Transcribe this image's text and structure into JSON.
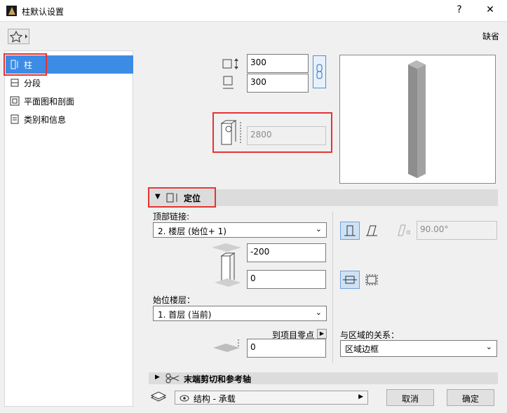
{
  "window": {
    "title": "柱默认设置",
    "help": "?",
    "close": "✕"
  },
  "toolbar": {
    "default_label": "缺省"
  },
  "nav": {
    "items": [
      {
        "label": "柱",
        "selected": true
      },
      {
        "label": "分段"
      },
      {
        "label": "平面图和剖面"
      },
      {
        "label": "类别和信息"
      }
    ]
  },
  "dimensions": {
    "width": "300",
    "depth": "300",
    "height": "2800"
  },
  "positioning": {
    "title": "定位",
    "top_link_label": "顶部链接:",
    "top_link_value": "2. 楼层 (始位+ 1)",
    "top_offset": "-200",
    "bottom_offset": "0",
    "home_story_label": "始位楼层：",
    "home_story_value": "1. 首层 (当前)",
    "to_project_zero_label": "到项目零点",
    "to_project_zero_value": "0",
    "angle_value": "90.00°",
    "zone_relation_label": "与区域的关系：",
    "zone_relation_value": "区域边框"
  },
  "sections": {
    "end_cut_title": "末端剪切和参考轴"
  },
  "footer": {
    "layer_value": "结构 - 承载",
    "cancel_label": "取消",
    "ok_label": "确定"
  },
  "colors": {
    "selection": "#3c8ce6",
    "highlight_box": "#e53333"
  }
}
